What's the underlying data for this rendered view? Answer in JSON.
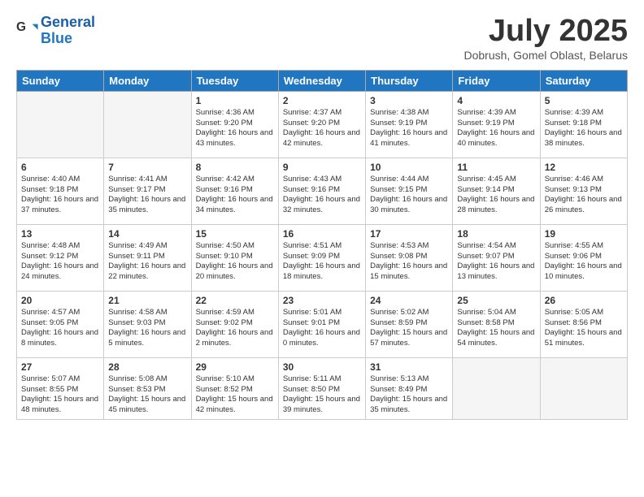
{
  "header": {
    "logo_line1": "General",
    "logo_line2": "Blue",
    "month_title": "July 2025",
    "location": "Dobrush, Gomel Oblast, Belarus"
  },
  "days_of_week": [
    "Sunday",
    "Monday",
    "Tuesday",
    "Wednesday",
    "Thursday",
    "Friday",
    "Saturday"
  ],
  "weeks": [
    [
      {
        "day": "",
        "info": ""
      },
      {
        "day": "",
        "info": ""
      },
      {
        "day": "1",
        "info": "Sunrise: 4:36 AM\nSunset: 9:20 PM\nDaylight: 16 hours\nand 43 minutes."
      },
      {
        "day": "2",
        "info": "Sunrise: 4:37 AM\nSunset: 9:20 PM\nDaylight: 16 hours\nand 42 minutes."
      },
      {
        "day": "3",
        "info": "Sunrise: 4:38 AM\nSunset: 9:19 PM\nDaylight: 16 hours\nand 41 minutes."
      },
      {
        "day": "4",
        "info": "Sunrise: 4:39 AM\nSunset: 9:19 PM\nDaylight: 16 hours\nand 40 minutes."
      },
      {
        "day": "5",
        "info": "Sunrise: 4:39 AM\nSunset: 9:18 PM\nDaylight: 16 hours\nand 38 minutes."
      }
    ],
    [
      {
        "day": "6",
        "info": "Sunrise: 4:40 AM\nSunset: 9:18 PM\nDaylight: 16 hours\nand 37 minutes."
      },
      {
        "day": "7",
        "info": "Sunrise: 4:41 AM\nSunset: 9:17 PM\nDaylight: 16 hours\nand 35 minutes."
      },
      {
        "day": "8",
        "info": "Sunrise: 4:42 AM\nSunset: 9:16 PM\nDaylight: 16 hours\nand 34 minutes."
      },
      {
        "day": "9",
        "info": "Sunrise: 4:43 AM\nSunset: 9:16 PM\nDaylight: 16 hours\nand 32 minutes."
      },
      {
        "day": "10",
        "info": "Sunrise: 4:44 AM\nSunset: 9:15 PM\nDaylight: 16 hours\nand 30 minutes."
      },
      {
        "day": "11",
        "info": "Sunrise: 4:45 AM\nSunset: 9:14 PM\nDaylight: 16 hours\nand 28 minutes."
      },
      {
        "day": "12",
        "info": "Sunrise: 4:46 AM\nSunset: 9:13 PM\nDaylight: 16 hours\nand 26 minutes."
      }
    ],
    [
      {
        "day": "13",
        "info": "Sunrise: 4:48 AM\nSunset: 9:12 PM\nDaylight: 16 hours\nand 24 minutes."
      },
      {
        "day": "14",
        "info": "Sunrise: 4:49 AM\nSunset: 9:11 PM\nDaylight: 16 hours\nand 22 minutes."
      },
      {
        "day": "15",
        "info": "Sunrise: 4:50 AM\nSunset: 9:10 PM\nDaylight: 16 hours\nand 20 minutes."
      },
      {
        "day": "16",
        "info": "Sunrise: 4:51 AM\nSunset: 9:09 PM\nDaylight: 16 hours\nand 18 minutes."
      },
      {
        "day": "17",
        "info": "Sunrise: 4:53 AM\nSunset: 9:08 PM\nDaylight: 16 hours\nand 15 minutes."
      },
      {
        "day": "18",
        "info": "Sunrise: 4:54 AM\nSunset: 9:07 PM\nDaylight: 16 hours\nand 13 minutes."
      },
      {
        "day": "19",
        "info": "Sunrise: 4:55 AM\nSunset: 9:06 PM\nDaylight: 16 hours\nand 10 minutes."
      }
    ],
    [
      {
        "day": "20",
        "info": "Sunrise: 4:57 AM\nSunset: 9:05 PM\nDaylight: 16 hours\nand 8 minutes."
      },
      {
        "day": "21",
        "info": "Sunrise: 4:58 AM\nSunset: 9:03 PM\nDaylight: 16 hours\nand 5 minutes."
      },
      {
        "day": "22",
        "info": "Sunrise: 4:59 AM\nSunset: 9:02 PM\nDaylight: 16 hours\nand 2 minutes."
      },
      {
        "day": "23",
        "info": "Sunrise: 5:01 AM\nSunset: 9:01 PM\nDaylight: 16 hours\nand 0 minutes."
      },
      {
        "day": "24",
        "info": "Sunrise: 5:02 AM\nSunset: 8:59 PM\nDaylight: 15 hours\nand 57 minutes."
      },
      {
        "day": "25",
        "info": "Sunrise: 5:04 AM\nSunset: 8:58 PM\nDaylight: 15 hours\nand 54 minutes."
      },
      {
        "day": "26",
        "info": "Sunrise: 5:05 AM\nSunset: 8:56 PM\nDaylight: 15 hours\nand 51 minutes."
      }
    ],
    [
      {
        "day": "27",
        "info": "Sunrise: 5:07 AM\nSunset: 8:55 PM\nDaylight: 15 hours\nand 48 minutes."
      },
      {
        "day": "28",
        "info": "Sunrise: 5:08 AM\nSunset: 8:53 PM\nDaylight: 15 hours\nand 45 minutes."
      },
      {
        "day": "29",
        "info": "Sunrise: 5:10 AM\nSunset: 8:52 PM\nDaylight: 15 hours\nand 42 minutes."
      },
      {
        "day": "30",
        "info": "Sunrise: 5:11 AM\nSunset: 8:50 PM\nDaylight: 15 hours\nand 39 minutes."
      },
      {
        "day": "31",
        "info": "Sunrise: 5:13 AM\nSunset: 8:49 PM\nDaylight: 15 hours\nand 35 minutes."
      },
      {
        "day": "",
        "info": ""
      },
      {
        "day": "",
        "info": ""
      }
    ]
  ]
}
